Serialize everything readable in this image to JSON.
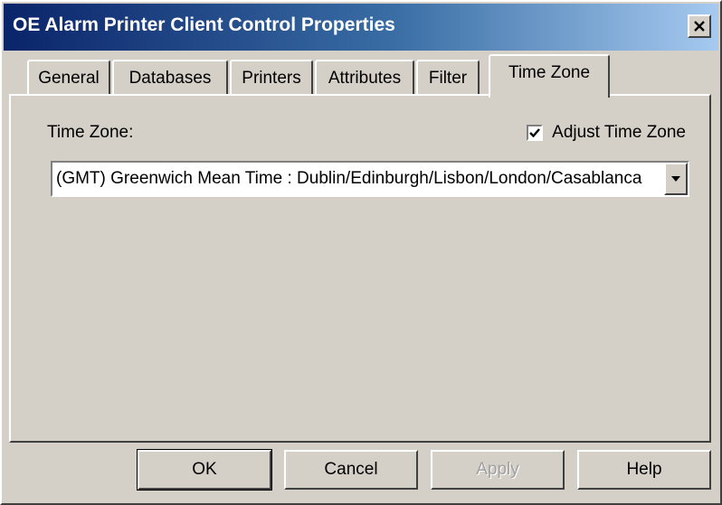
{
  "window": {
    "title": "OE Alarm Printer Client Control Properties"
  },
  "tabs": [
    {
      "label": "General",
      "active": false
    },
    {
      "label": "Databases",
      "active": false
    },
    {
      "label": "Printers",
      "active": false
    },
    {
      "label": "Attributes",
      "active": false
    },
    {
      "label": "Filter",
      "active": false
    },
    {
      "label": "Time Zone",
      "active": true
    }
  ],
  "time_zone": {
    "label": "Time Zone:",
    "adjust_label": "Adjust Time Zone",
    "adjust_checked": true,
    "selected": "(GMT) Greenwich Mean Time : Dublin/Edinburgh/Lisbon/London/Casablanca"
  },
  "buttons": {
    "ok": "OK",
    "cancel": "Cancel",
    "apply": "Apply",
    "help": "Help"
  }
}
